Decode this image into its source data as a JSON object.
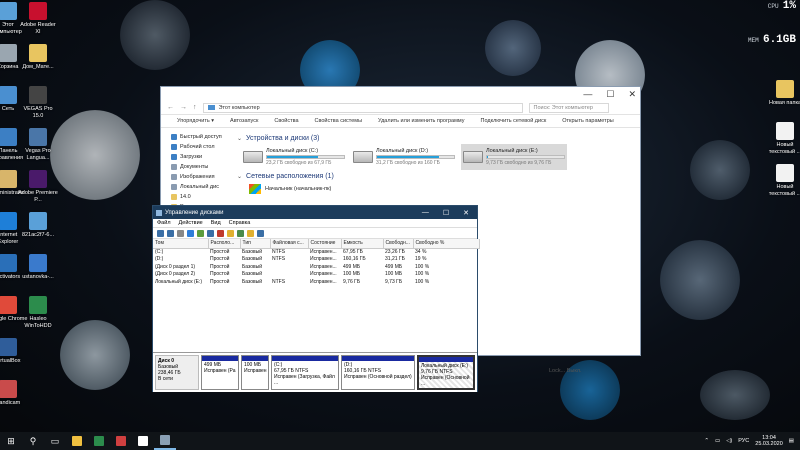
{
  "desktop": {
    "icons_left": [
      {
        "label": "Этот компьютер",
        "color": "#5aa0d8"
      },
      {
        "label": "Корзина",
        "color": "#9aa6b0"
      },
      {
        "label": "Сеть",
        "color": "#4a8fd0"
      },
      {
        "label": "Панель управления",
        "color": "#3c7fc4"
      },
      {
        "label": "Administrator",
        "color": "#d8b56a"
      },
      {
        "label": "Internet Explorer",
        "color": "#1e7fd8"
      },
      {
        "label": "Activators",
        "color": "#2a6fb8"
      },
      {
        "label": "Google Chrome",
        "color": "#e04a3a"
      },
      {
        "label": "VirtualBox",
        "color": "#2f5d9a"
      },
      {
        "label": "Bandicam",
        "color": "#c94b4b"
      }
    ],
    "icons_col2": [
      {
        "label": "Adobe Reader XI",
        "color": "#c8102e"
      },
      {
        "label": "Дом_Мате...",
        "color": "#e8c560"
      },
      {
        "label": "VEGAS Pro 15.0",
        "color": "#444444"
      },
      {
        "label": "Vegas Pro Langua...",
        "color": "#4a76a8"
      },
      {
        "label": "Adobe Premiere P...",
        "color": "#4a1a6a"
      },
      {
        "label": "821ac2f7-6...",
        "color": "#5aa0d8"
      },
      {
        "label": "ustanovka-...",
        "color": "#3a7acc"
      },
      {
        "label": "Hasleo WinToHDD",
        "color": "#2c8c4c"
      }
    ],
    "icons_right": [
      {
        "label": "Новая папка",
        "color": "#e8c560"
      },
      {
        "label": "Новый текстовый ...",
        "color": "#f2f2f2"
      },
      {
        "label": "Новый текстовый ...",
        "color": "#f2f2f2"
      }
    ],
    "meter": {
      "cpu_label": "CPU",
      "cpu_value": "1%",
      "mem_label": "MEM",
      "mem_value": "6.1GB"
    }
  },
  "explorer": {
    "controls": [
      "—",
      "☐",
      "✕"
    ],
    "address": "Этот компьютер",
    "search_placeholder": "Поиск: Этот компьютер",
    "toolbar": [
      "Упорядочить ▾",
      "Автозапуск",
      "Свойства",
      "Свойства системы",
      "Удалить или изменить программу",
      "Подключить сетевой диск",
      "Открыть параметры"
    ],
    "nav": [
      {
        "label": "Быстрый доступ",
        "color": "#3c7fc4"
      },
      {
        "label": "Рабочий стол",
        "color": "#3c7fc4"
      },
      {
        "label": "Загрузки",
        "color": "#3c7fc4"
      },
      {
        "label": "Документы",
        "color": "#8a9bb0"
      },
      {
        "label": "Изображения",
        "color": "#8a9bb0"
      },
      {
        "label": "Локальный дис",
        "color": "#8a9bb0"
      },
      {
        "label": "14.0",
        "color": "#e8c560"
      },
      {
        "label": "Ра",
        "color": "#e8c560"
      }
    ],
    "devices_heading": "Устройства и диски (3)",
    "drives": [
      {
        "name": "Локальный диск (C:)",
        "free": "23,2 ГБ свободно из 67,9 ГБ",
        "used": 0.66
      },
      {
        "name": "Локальный диск (D:)",
        "free": "31,2 ГБ свободно из 160 ГБ",
        "used": 0.81
      },
      {
        "name": "Локальный диск (E:)",
        "free": "9,73 ГБ свободно из 9,76 ГБ",
        "used": 0.01
      }
    ],
    "network_heading": "Сетевые расположения (1)",
    "network_item": "Начальник (начальник-пк)",
    "bottom_text": "Lock...    Выкл."
  },
  "disk_mgmt": {
    "title": "Управление дисками",
    "controls": [
      "—",
      "☐",
      "✕"
    ],
    "menu": [
      "Файл",
      "Действие",
      "Вид",
      "Справка"
    ],
    "toolbar_colors": [
      "#3a6ea5",
      "#3a6ea5",
      "#888888",
      "#2f7ed8",
      "#5c9c3c",
      "#3a6ea5",
      "#c0392b",
      "#e0b030",
      "#4a8a4a",
      "#e0b030",
      "#3a6ea5"
    ],
    "columns": [
      "Том",
      "Располо...",
      "Тип",
      "Файловая с...",
      "Состояние",
      "Емкость",
      "Свободн...",
      "Свободно %"
    ],
    "rows": [
      [
        "(C:)",
        "Простой",
        "Базовый",
        "NTFS",
        "Исправен...",
        "67,95 ГБ",
        "23,26 ГБ",
        "34 %"
      ],
      [
        "(D:)",
        "Простой",
        "Базовый",
        "NTFS",
        "Исправен...",
        "160,16 ГБ",
        "31,21 ГБ",
        "19 %"
      ],
      [
        "(Диск 0 раздел 1)",
        "Простой",
        "Базовый",
        "",
        "Исправен...",
        "499 МБ",
        "499 МБ",
        "100 %"
      ],
      [
        "(Диск 0 раздел 2)",
        "Простой",
        "Базовый",
        "",
        "Исправен...",
        "100 МБ",
        "100 МБ",
        "100 %"
      ],
      [
        "Локальный диск (E:)",
        "Простой",
        "Базовый",
        "NTFS",
        "Исправен...",
        "9,76 ГБ",
        "9,73 ГБ",
        "100 %"
      ]
    ],
    "disk_label": {
      "name": "Диск 0",
      "type": "Базовый",
      "size": "238,46 ГБ",
      "status": "В сети"
    },
    "partitions": [
      {
        "name": "",
        "size": "499 МБ",
        "status": "Исправен (Ра"
      },
      {
        "name": "",
        "size": "100 МБ",
        "status": "Исправен"
      },
      {
        "name": "(C:)",
        "size": "67,95 ГБ NTFS",
        "status": "Исправен (Загрузка, Файл ..."
      },
      {
        "name": "(D:)",
        "size": "160,16 ГБ NTFS",
        "status": "Исправен (Основной раздел)"
      },
      {
        "name": "Локальный диск (E:)",
        "size": "9,76 ГБ NTFS",
        "status": "Исправен (Основной ..."
      }
    ]
  },
  "taskbar": {
    "start_icon": "⊞",
    "search_icon": "⚲",
    "apps": [
      "#f0c040",
      "#2c8c4c",
      "#d04040",
      "#ffffff",
      "#8aa0b5"
    ],
    "lang": "РУС",
    "time": "13:04",
    "date": "25.03.2020"
  }
}
